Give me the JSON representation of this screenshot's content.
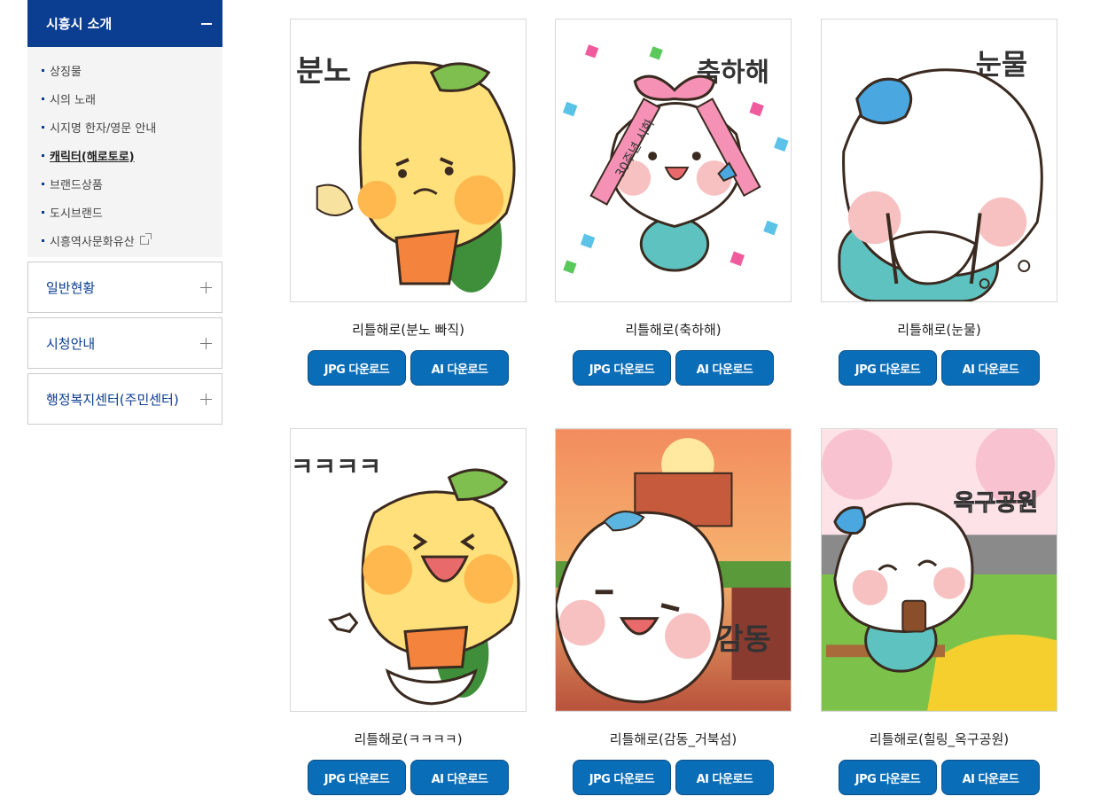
{
  "sidebar": {
    "section_title": "시흥시 소개",
    "sub_items": [
      {
        "label": "상징물"
      },
      {
        "label": "시의 노래"
      },
      {
        "label": "시지명 한자/영문 안내"
      },
      {
        "label": "캐릭터(해로토로)"
      },
      {
        "label": "브랜드상품"
      },
      {
        "label": "도시브랜드"
      },
      {
        "label": "시흥역사문화유산"
      }
    ],
    "menus": [
      {
        "label": "일반현황"
      },
      {
        "label": "시청안내"
      },
      {
        "label": "행정복지센터(주민센터)"
      }
    ]
  },
  "gallery": {
    "buttons": {
      "jpg": "JPG 다운로드",
      "ai": "AI 다운로드"
    },
    "items": [
      {
        "caption": "리틀해로(분노 빠직)",
        "image_text": "분노"
      },
      {
        "caption": "리틀해로(축하해)",
        "image_text": "축하해",
        "image_sub": "30주년 시화"
      },
      {
        "caption": "리틀해로(눈물)",
        "image_text": "눈물"
      },
      {
        "caption": "리틀해로(ㅋㅋㅋㅋ)",
        "image_text": "ㅋㅋㅋㅋ"
      },
      {
        "caption": "리틀해로(감동_거북섬)",
        "image_text": "감동"
      },
      {
        "caption": "리틀해로(힐링_옥구공원)",
        "image_text": "옥구공원"
      }
    ]
  },
  "colors": {
    "primary": "#0b3d91",
    "button": "#0a6db8"
  }
}
